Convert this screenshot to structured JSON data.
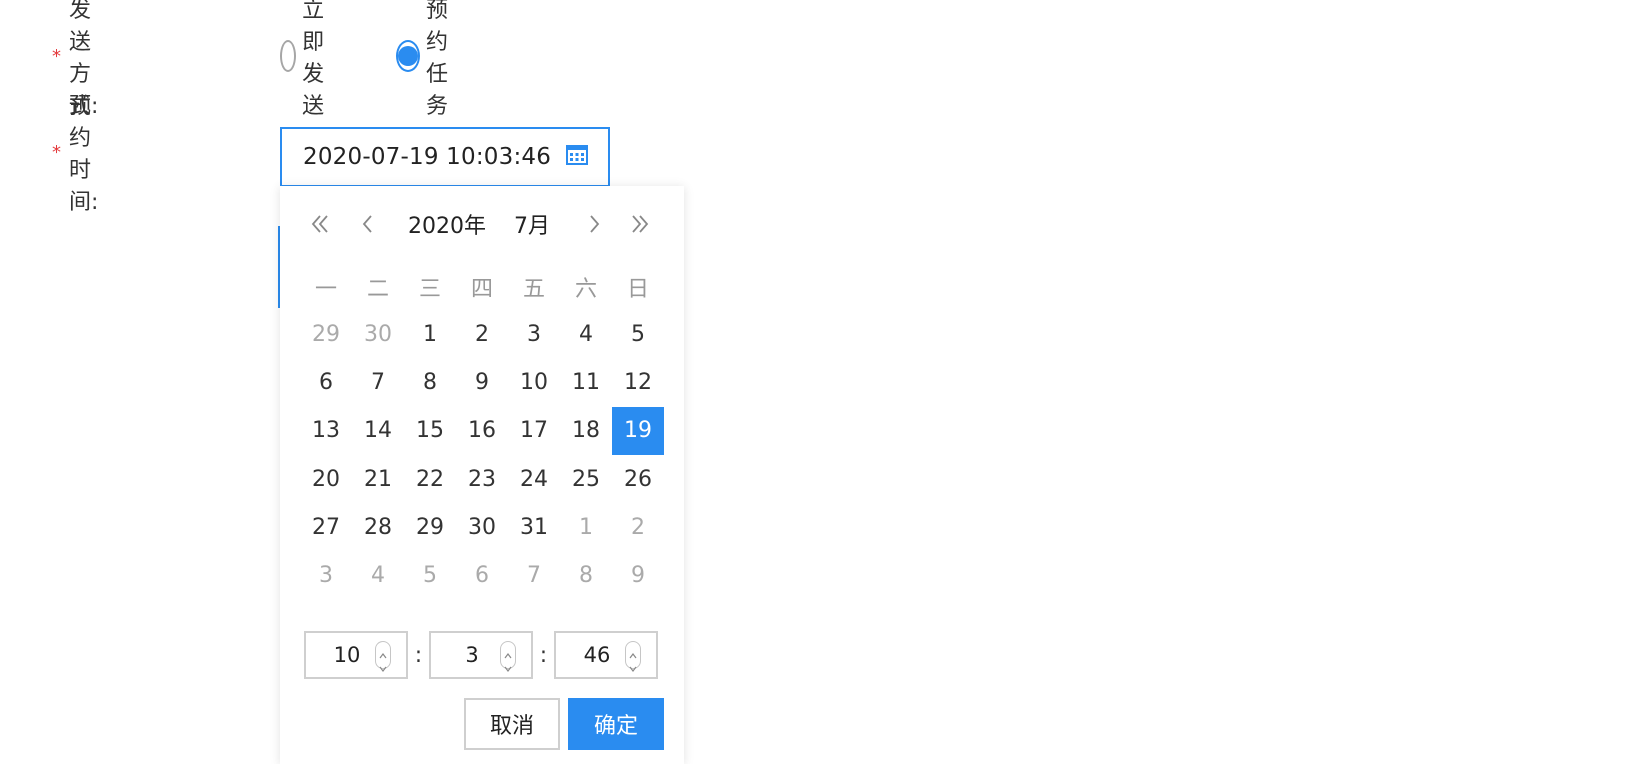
{
  "form": {
    "method_label": "发送方式:",
    "time_label": "预约时间:",
    "required_mark": "*",
    "options": [
      {
        "label": "立即发送",
        "checked": false
      },
      {
        "label": "预约任务",
        "checked": true
      }
    ],
    "datetime_value": "2020-07-19 10:03:46"
  },
  "picker": {
    "year_label": "2020年",
    "month_label": "7月",
    "weekdays": [
      "一",
      "二",
      "三",
      "四",
      "五",
      "六",
      "日"
    ],
    "weeks": [
      [
        {
          "d": "29",
          "o": true
        },
        {
          "d": "30",
          "o": true
        },
        {
          "d": "1"
        },
        {
          "d": "2"
        },
        {
          "d": "3"
        },
        {
          "d": "4"
        },
        {
          "d": "5"
        }
      ],
      [
        {
          "d": "6"
        },
        {
          "d": "7"
        },
        {
          "d": "8"
        },
        {
          "d": "9"
        },
        {
          "d": "10"
        },
        {
          "d": "11"
        },
        {
          "d": "12"
        }
      ],
      [
        {
          "d": "13"
        },
        {
          "d": "14"
        },
        {
          "d": "15"
        },
        {
          "d": "16"
        },
        {
          "d": "17"
        },
        {
          "d": "18"
        },
        {
          "d": "19",
          "s": true
        }
      ],
      [
        {
          "d": "20"
        },
        {
          "d": "21"
        },
        {
          "d": "22"
        },
        {
          "d": "23"
        },
        {
          "d": "24"
        },
        {
          "d": "25"
        },
        {
          "d": "26"
        }
      ],
      [
        {
          "d": "27"
        },
        {
          "d": "28"
        },
        {
          "d": "29"
        },
        {
          "d": "30"
        },
        {
          "d": "31"
        },
        {
          "d": "1",
          "o": true
        },
        {
          "d": "2",
          "o": true
        }
      ],
      [
        {
          "d": "3",
          "o": true
        },
        {
          "d": "4",
          "o": true
        },
        {
          "d": "5",
          "o": true
        },
        {
          "d": "6",
          "o": true
        },
        {
          "d": "7",
          "o": true
        },
        {
          "d": "8",
          "o": true
        },
        {
          "d": "9",
          "o": true
        }
      ]
    ],
    "time": {
      "hour": "10",
      "minute": "3",
      "second": "46",
      "separator": ":"
    },
    "cancel_label": "取消",
    "ok_label": "确定"
  },
  "icons": {
    "calendar": "calendar-icon",
    "prev_year": "double-chevron-left-icon",
    "prev_month": "chevron-left-icon",
    "next_month": "chevron-right-icon",
    "next_year": "double-chevron-right-icon"
  },
  "colors": {
    "accent": "#2a8cf0",
    "required": "#e4393c",
    "muted": "#aaaaaa"
  }
}
